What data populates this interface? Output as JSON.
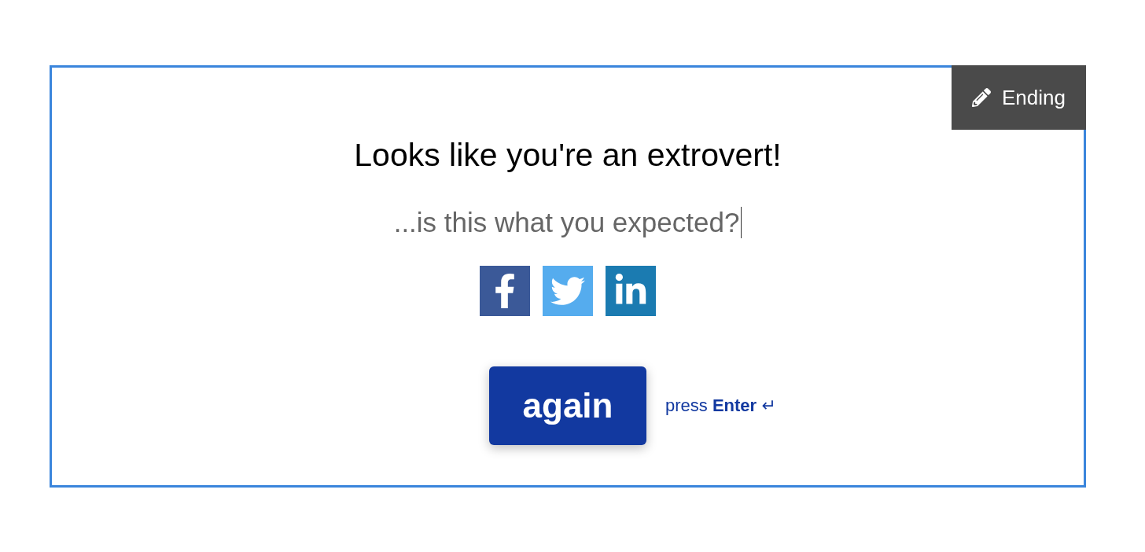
{
  "badge": {
    "label": "Ending"
  },
  "title": "Looks like you're an extrovert!",
  "subtitle": "...is this what you expected?",
  "share": [
    {
      "kind": "facebook"
    },
    {
      "kind": "twitter"
    },
    {
      "kind": "linkedin"
    }
  ],
  "button": {
    "label": "again"
  },
  "hint": "press **Enter** ↵"
}
